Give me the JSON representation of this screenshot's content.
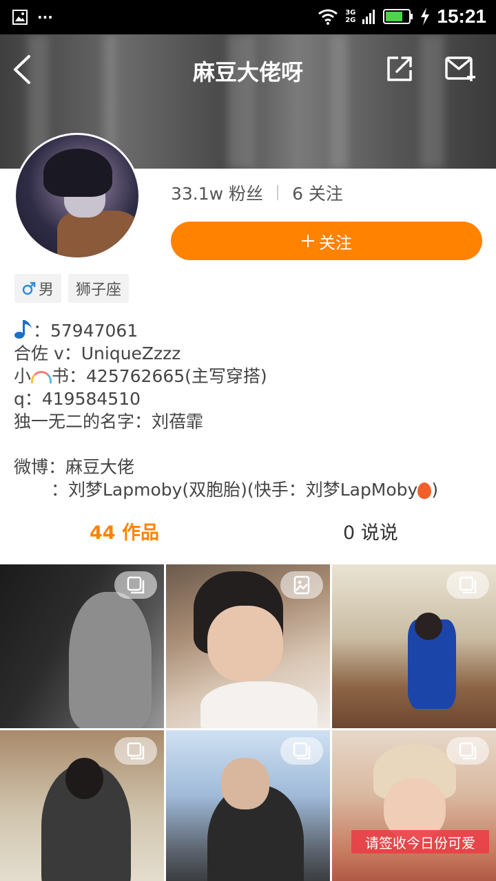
{
  "status_bar": {
    "time": "15:21",
    "net_top": "3G",
    "net_bottom": "2G",
    "dots": "···"
  },
  "nav": {
    "title": "麻豆大佬呀"
  },
  "profile": {
    "followers": "33.1w 粉丝",
    "following": "6 关注",
    "follow_button": "关注",
    "tags": [
      "男",
      "狮子座"
    ]
  },
  "bio": {
    "l1": "：57947061",
    "l2": "合佐 v：UniqueZzzz",
    "l3a": "小",
    "l3b": "书：425762665(主写穿搭)",
    "l4": "q：419584510",
    "l5": "独一无二的名字：刘蓓霏",
    "l6": "微博：麻豆大佬",
    "l7": "：刘梦Lapmoby(双胞胎)(快手：刘梦LapMoby",
    "l7_end": ")"
  },
  "tabs": {
    "works": "44 作品",
    "posts": "0 说说"
  },
  "grid": {
    "caption": "请签收今日份可爱"
  },
  "colors": {
    "accent": "#ff8200",
    "male": "#2f8ae0"
  }
}
